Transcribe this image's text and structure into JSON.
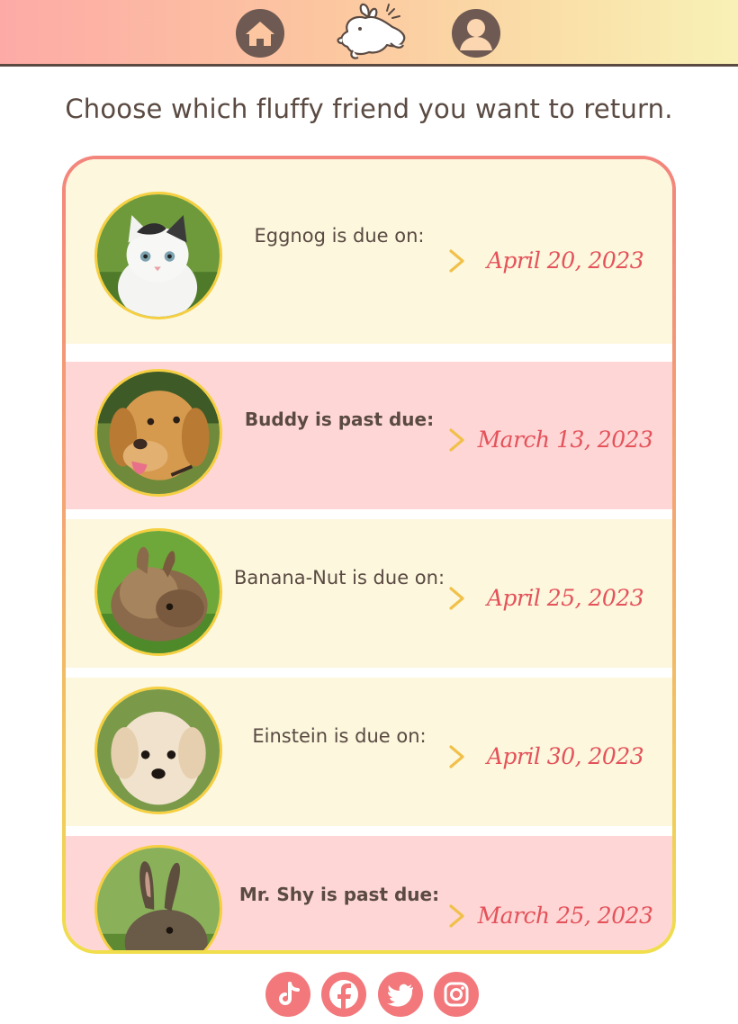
{
  "header": {
    "home_icon": "home-icon",
    "logo_icon": "bunny-logo-icon",
    "profile_icon": "user-icon"
  },
  "instruction": "Choose which fluffy friend you want to return.",
  "pets": [
    {
      "name": "Eggnog",
      "status_text": "Eggnog is due on:",
      "date": "April 20, 2023",
      "state": "due",
      "animal": "kitten"
    },
    {
      "name": "Buddy",
      "status_text": "Buddy is past due:",
      "date": "March 13, 2023",
      "state": "past",
      "animal": "golden-retriever"
    },
    {
      "name": "Banana-Nut",
      "status_text": "Banana-Nut is due on:",
      "date": "April 25, 2023",
      "state": "due",
      "animal": "lionhead-rabbit"
    },
    {
      "name": "Einstein",
      "status_text": "Einstein is due on:",
      "date": "April 30, 2023",
      "state": "due",
      "animal": "puppy"
    },
    {
      "name": "Mr. Shy",
      "status_text": "Mr. Shy is past due:",
      "date": "March 25, 2023",
      "state": "past",
      "animal": "wild-rabbit"
    }
  ],
  "colors": {
    "due_row": "#fcf7dd",
    "past_row": "#fed6d6",
    "date_text": "#e4525a",
    "social_bg": "#f2787c",
    "icon_brown": "#6e5a52"
  },
  "social": [
    "tiktok-icon",
    "facebook-icon",
    "twitter-icon",
    "instagram-icon"
  ]
}
